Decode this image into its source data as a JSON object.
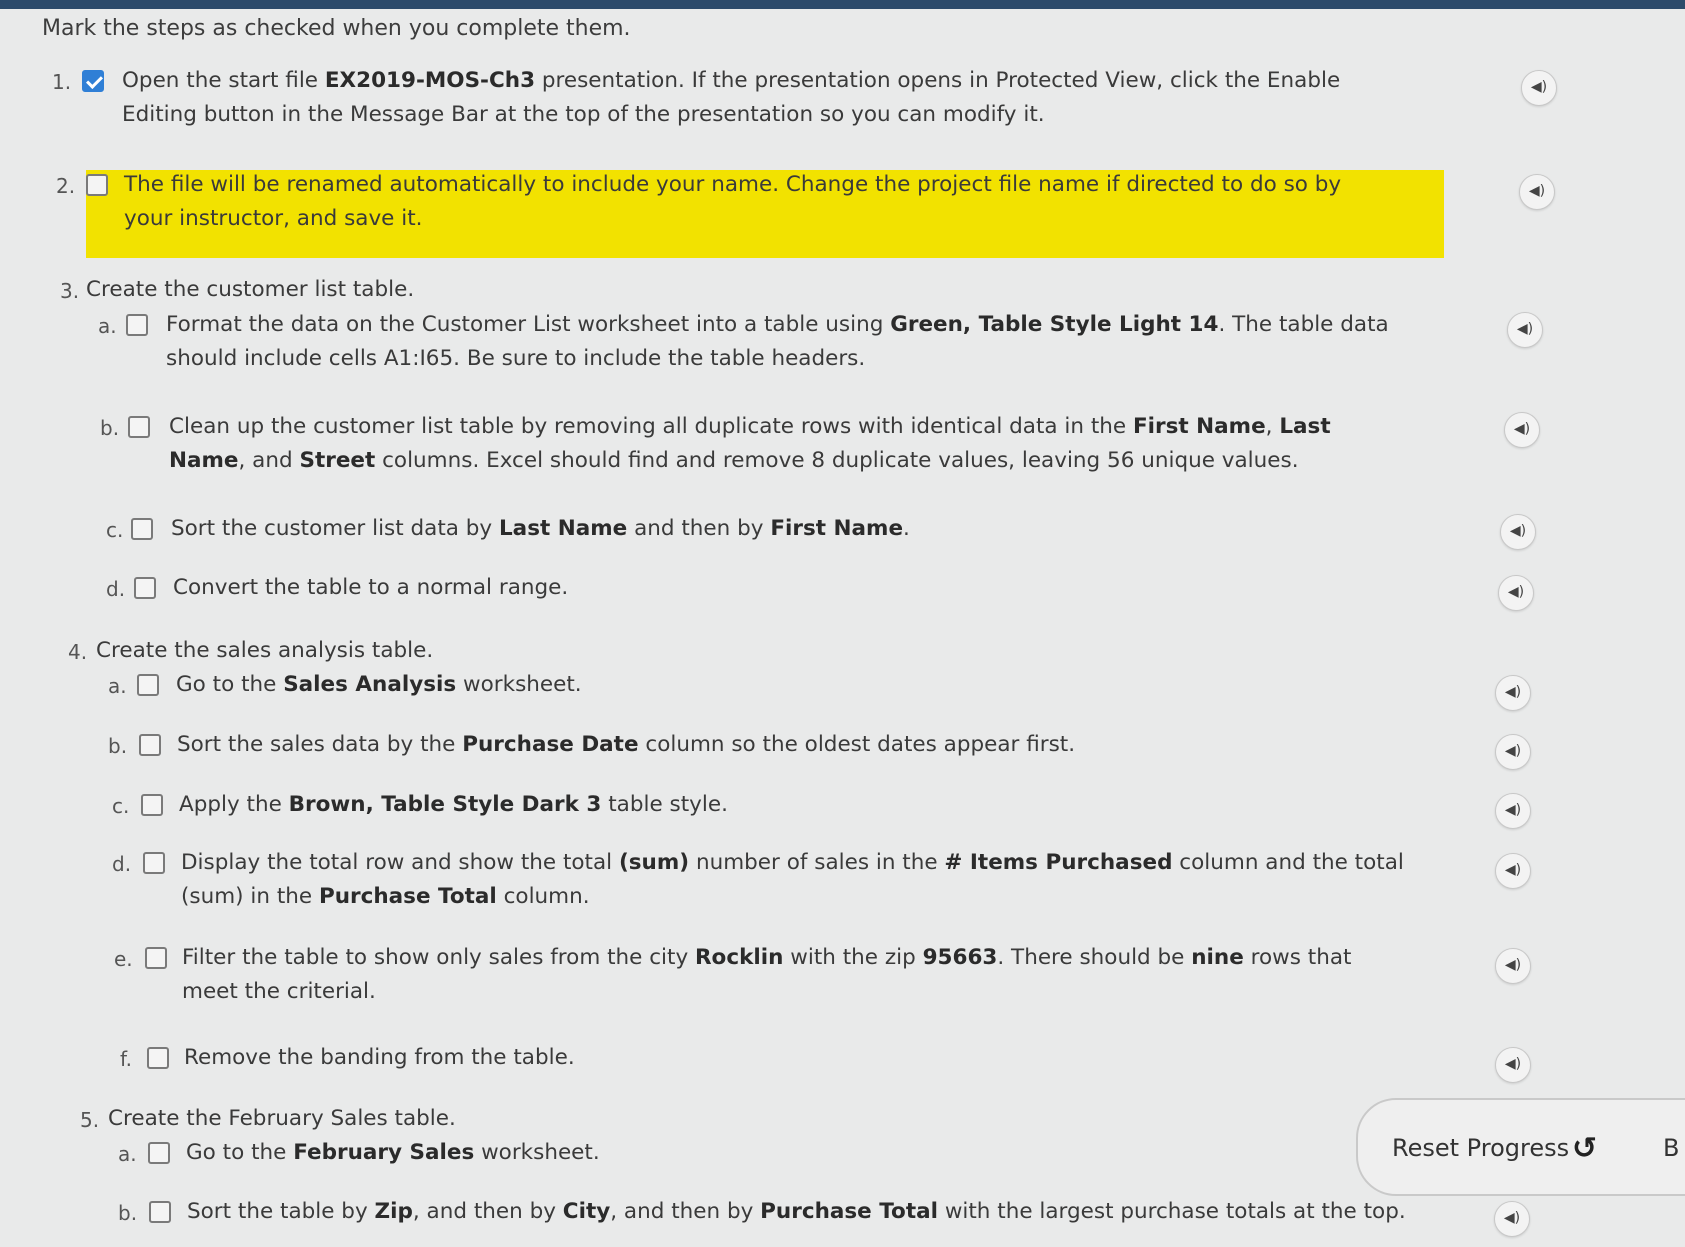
{
  "intro": "Mark the steps as checked when you complete them.",
  "steps": [
    {
      "num": "1.",
      "checked": true,
      "text": "Open the start file <b>EX2019-MOS-Ch3</b> presentation. If the presentation opens in Protected View, click the Enable Editing button in the Message Bar at the top of the presentation so you can modify it."
    },
    {
      "num": "2.",
      "checked": false,
      "text": "The file will be renamed automatically to include your name. Change the project file name if directed to do so by your instructor, and save it."
    },
    {
      "num": "3.",
      "text": "Create the customer list table."
    },
    {
      "num": "a.",
      "checked": false,
      "text": "Format the data on the Customer List worksheet into a table using <b>Green, Table Style Light 14</b>. The table data should include cells A1:I65. Be sure to include the table headers."
    },
    {
      "num": "b.",
      "checked": false,
      "text": "Clean up the customer list table by removing all duplicate rows with identical data in the <b>First Name</b>, <b>Last Name</b>, and <b>Street</b> columns. Excel should find and remove 8 duplicate values, leaving 56 unique values."
    },
    {
      "num": "c.",
      "checked": false,
      "text": "Sort the customer list data by <b>Last Name</b> and then by <b>First Name</b>."
    },
    {
      "num": "d.",
      "checked": false,
      "text": "Convert the table to a normal range."
    },
    {
      "num": "4.",
      "text": "Create the sales analysis table."
    },
    {
      "num": "a.",
      "checked": false,
      "text": "Go to the <b>Sales Analysis</b> worksheet."
    },
    {
      "num": "b.",
      "checked": false,
      "text": "Sort the sales data by the <b>Purchase Date</b> column so the oldest dates appear first."
    },
    {
      "num": "c.",
      "checked": false,
      "text": "Apply the <b>Brown, Table Style Dark 3</b> table style."
    },
    {
      "num": "d.",
      "checked": false,
      "text": "Display the total row and show the total <b>(sum)</b> number of sales in the <b># Items Purchased</b> column and the total (sum) in the <b>Purchase Total</b> column."
    },
    {
      "num": "e.",
      "checked": false,
      "text": "Filter the table to show only sales from the city <b>Rocklin</b> with the zip <b>95663</b>. There should be <b>nine</b> rows that meet the criterial."
    },
    {
      "num": "f.",
      "checked": false,
      "text": "Remove the banding from the table."
    },
    {
      "num": "5.",
      "text": "Create the February Sales table."
    },
    {
      "num": "a.",
      "checked": false,
      "text": "Go to the <b>February Sales</b> worksheet."
    },
    {
      "num": "b.",
      "checked": false,
      "text": "Sort the table by <b>Zip</b>, and then by <b>City</b>, and then by <b>Purchase Total</b> with the largest purchase totals at the top."
    }
  ],
  "audio_icon": "speaker-icon",
  "audio_glyph": "◀)",
  "reset": {
    "label": "Reset Progress",
    "icon": "↺",
    "cut_label": "B"
  },
  "colors": {
    "highlight": "#f2e200",
    "checkbox_checked": "#2f7fd6"
  }
}
